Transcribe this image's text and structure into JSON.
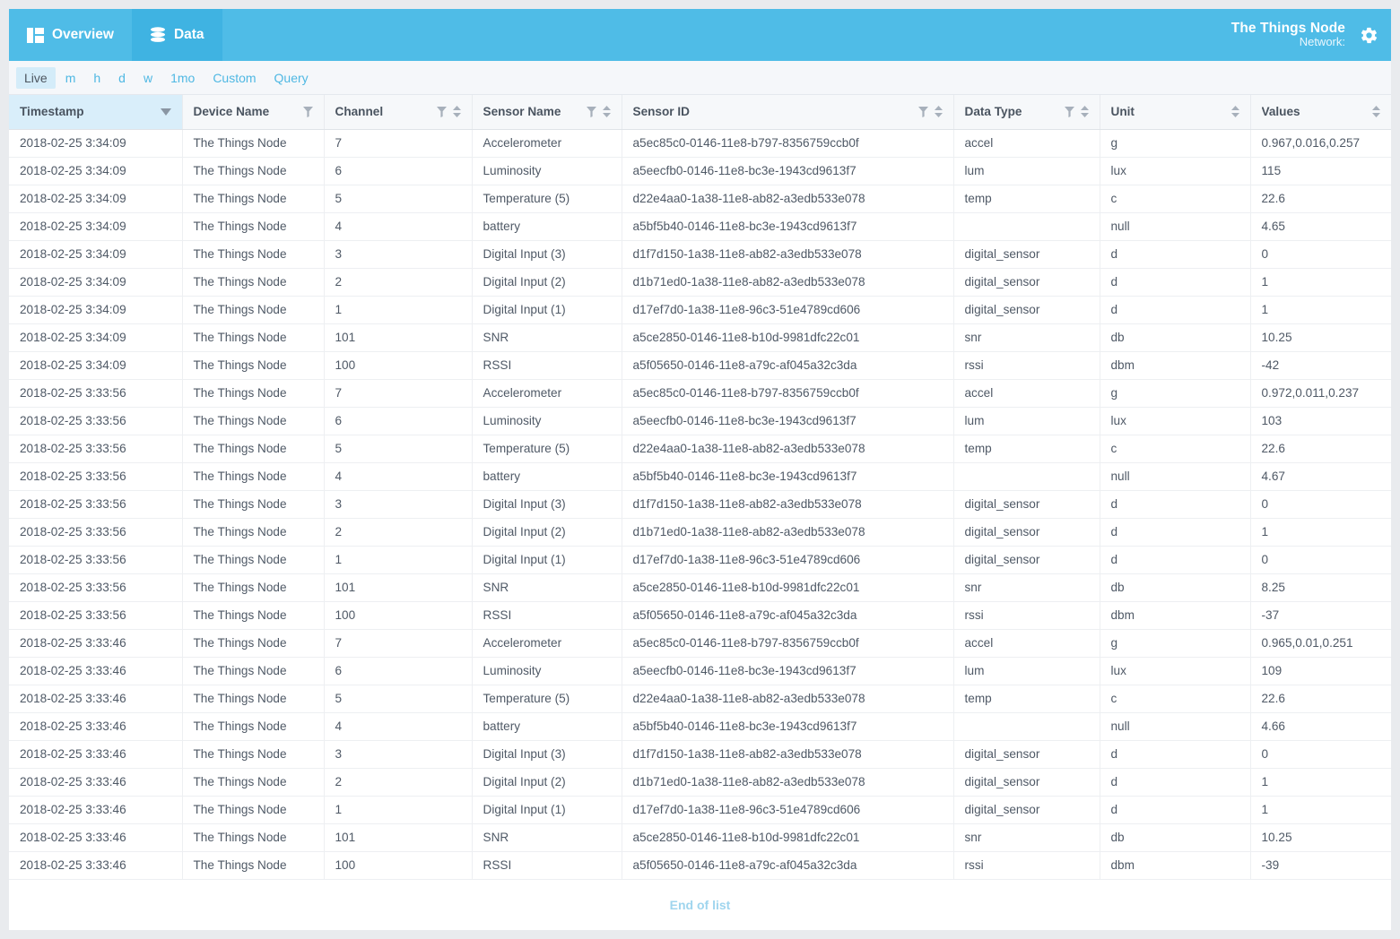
{
  "appbar": {
    "tabs": [
      {
        "label": "Overview",
        "icon": "dashboard-icon",
        "active": false
      },
      {
        "label": "Data",
        "icon": "database-icon",
        "active": true
      }
    ],
    "brand_title": "The Things Node",
    "brand_subtitle": "Network:",
    "settings_icon": "gear-icon",
    "accent_color": "#4fbce7",
    "accent_active_color": "#3fb3e2"
  },
  "range_bar": {
    "items": [
      {
        "label": "Live",
        "active": true
      },
      {
        "label": "m",
        "active": false
      },
      {
        "label": "h",
        "active": false
      },
      {
        "label": "d",
        "active": false
      },
      {
        "label": "w",
        "active": false
      },
      {
        "label": "1mo",
        "active": false
      },
      {
        "label": "Custom",
        "active": false
      },
      {
        "label": "Query",
        "active": false
      }
    ],
    "link_color": "#4fb8e3",
    "active_bg": "#d4ecf9"
  },
  "table": {
    "columns": [
      {
        "key": "timestamp",
        "label": "Timestamp",
        "filter": false,
        "sort": false,
        "sorted": true,
        "sort_dir": "desc"
      },
      {
        "key": "device_name",
        "label": "Device Name",
        "filter": true,
        "sort": false,
        "sorted": false,
        "sort_dir": ""
      },
      {
        "key": "channel",
        "label": "Channel",
        "filter": true,
        "sort": true,
        "sorted": false,
        "sort_dir": ""
      },
      {
        "key": "sensor_name",
        "label": "Sensor Name",
        "filter": true,
        "sort": true,
        "sorted": false,
        "sort_dir": ""
      },
      {
        "key": "sensor_id",
        "label": "Sensor ID",
        "filter": true,
        "sort": true,
        "sorted": false,
        "sort_dir": ""
      },
      {
        "key": "data_type",
        "label": "Data Type",
        "filter": true,
        "sort": true,
        "sorted": false,
        "sort_dir": ""
      },
      {
        "key": "unit",
        "label": "Unit",
        "filter": false,
        "sort": true,
        "sorted": false,
        "sort_dir": ""
      },
      {
        "key": "values",
        "label": "Values",
        "filter": false,
        "sort": true,
        "sorted": false,
        "sort_dir": ""
      }
    ],
    "rows": [
      [
        "2018-02-25 3:34:09",
        "The Things Node",
        "7",
        "Accelerometer",
        "a5ec85c0-0146-11e8-b797-8356759ccb0f",
        "accel",
        "g",
        "0.967,0.016,0.257"
      ],
      [
        "2018-02-25 3:34:09",
        "The Things Node",
        "6",
        "Luminosity",
        "a5eecfb0-0146-11e8-bc3e-1943cd9613f7",
        "lum",
        "lux",
        "115"
      ],
      [
        "2018-02-25 3:34:09",
        "The Things Node",
        "5",
        "Temperature (5)",
        "d22e4aa0-1a38-11e8-ab82-a3edb533e078",
        "temp",
        "c",
        "22.6"
      ],
      [
        "2018-02-25 3:34:09",
        "The Things Node",
        "4",
        "battery",
        "a5bf5b40-0146-11e8-bc3e-1943cd9613f7",
        "",
        "null",
        "4.65"
      ],
      [
        "2018-02-25 3:34:09",
        "The Things Node",
        "3",
        "Digital Input (3)",
        "d1f7d150-1a38-11e8-ab82-a3edb533e078",
        "digital_sensor",
        "d",
        "0"
      ],
      [
        "2018-02-25 3:34:09",
        "The Things Node",
        "2",
        "Digital Input (2)",
        "d1b71ed0-1a38-11e8-ab82-a3edb533e078",
        "digital_sensor",
        "d",
        "1"
      ],
      [
        "2018-02-25 3:34:09",
        "The Things Node",
        "1",
        "Digital Input (1)",
        "d17ef7d0-1a38-11e8-96c3-51e4789cd606",
        "digital_sensor",
        "d",
        "1"
      ],
      [
        "2018-02-25 3:34:09",
        "The Things Node",
        "101",
        "SNR",
        "a5ce2850-0146-11e8-b10d-9981dfc22c01",
        "snr",
        "db",
        "10.25"
      ],
      [
        "2018-02-25 3:34:09",
        "The Things Node",
        "100",
        "RSSI",
        "a5f05650-0146-11e8-a79c-af045a32c3da",
        "rssi",
        "dbm",
        "-42"
      ],
      [
        "2018-02-25 3:33:56",
        "The Things Node",
        "7",
        "Accelerometer",
        "a5ec85c0-0146-11e8-b797-8356759ccb0f",
        "accel",
        "g",
        "0.972,0.011,0.237"
      ],
      [
        "2018-02-25 3:33:56",
        "The Things Node",
        "6",
        "Luminosity",
        "a5eecfb0-0146-11e8-bc3e-1943cd9613f7",
        "lum",
        "lux",
        "103"
      ],
      [
        "2018-02-25 3:33:56",
        "The Things Node",
        "5",
        "Temperature (5)",
        "d22e4aa0-1a38-11e8-ab82-a3edb533e078",
        "temp",
        "c",
        "22.6"
      ],
      [
        "2018-02-25 3:33:56",
        "The Things Node",
        "4",
        "battery",
        "a5bf5b40-0146-11e8-bc3e-1943cd9613f7",
        "",
        "null",
        "4.67"
      ],
      [
        "2018-02-25 3:33:56",
        "The Things Node",
        "3",
        "Digital Input (3)",
        "d1f7d150-1a38-11e8-ab82-a3edb533e078",
        "digital_sensor",
        "d",
        "0"
      ],
      [
        "2018-02-25 3:33:56",
        "The Things Node",
        "2",
        "Digital Input (2)",
        "d1b71ed0-1a38-11e8-ab82-a3edb533e078",
        "digital_sensor",
        "d",
        "1"
      ],
      [
        "2018-02-25 3:33:56",
        "The Things Node",
        "1",
        "Digital Input (1)",
        "d17ef7d0-1a38-11e8-96c3-51e4789cd606",
        "digital_sensor",
        "d",
        "0"
      ],
      [
        "2018-02-25 3:33:56",
        "The Things Node",
        "101",
        "SNR",
        "a5ce2850-0146-11e8-b10d-9981dfc22c01",
        "snr",
        "db",
        "8.25"
      ],
      [
        "2018-02-25 3:33:56",
        "The Things Node",
        "100",
        "RSSI",
        "a5f05650-0146-11e8-a79c-af045a32c3da",
        "rssi",
        "dbm",
        "-37"
      ],
      [
        "2018-02-25 3:33:46",
        "The Things Node",
        "7",
        "Accelerometer",
        "a5ec85c0-0146-11e8-b797-8356759ccb0f",
        "accel",
        "g",
        "0.965,0.01,0.251"
      ],
      [
        "2018-02-25 3:33:46",
        "The Things Node",
        "6",
        "Luminosity",
        "a5eecfb0-0146-11e8-bc3e-1943cd9613f7",
        "lum",
        "lux",
        "109"
      ],
      [
        "2018-02-25 3:33:46",
        "The Things Node",
        "5",
        "Temperature (5)",
        "d22e4aa0-1a38-11e8-ab82-a3edb533e078",
        "temp",
        "c",
        "22.6"
      ],
      [
        "2018-02-25 3:33:46",
        "The Things Node",
        "4",
        "battery",
        "a5bf5b40-0146-11e8-bc3e-1943cd9613f7",
        "",
        "null",
        "4.66"
      ],
      [
        "2018-02-25 3:33:46",
        "The Things Node",
        "3",
        "Digital Input (3)",
        "d1f7d150-1a38-11e8-ab82-a3edb533e078",
        "digital_sensor",
        "d",
        "0"
      ],
      [
        "2018-02-25 3:33:46",
        "The Things Node",
        "2",
        "Digital Input (2)",
        "d1b71ed0-1a38-11e8-ab82-a3edb533e078",
        "digital_sensor",
        "d",
        "1"
      ],
      [
        "2018-02-25 3:33:46",
        "The Things Node",
        "1",
        "Digital Input (1)",
        "d17ef7d0-1a38-11e8-96c3-51e4789cd606",
        "digital_sensor",
        "d",
        "1"
      ],
      [
        "2018-02-25 3:33:46",
        "The Things Node",
        "101",
        "SNR",
        "a5ce2850-0146-11e8-b10d-9981dfc22c01",
        "snr",
        "db",
        "10.25"
      ],
      [
        "2018-02-25 3:33:46",
        "The Things Node",
        "100",
        "RSSI",
        "a5f05650-0146-11e8-a79c-af045a32c3da",
        "rssi",
        "dbm",
        "-39"
      ]
    ],
    "column_widths": [
      "193px",
      "158px",
      "165px",
      "167px",
      "370px",
      "163px",
      "168px",
      "157px"
    ],
    "footer_text": "End of list"
  }
}
